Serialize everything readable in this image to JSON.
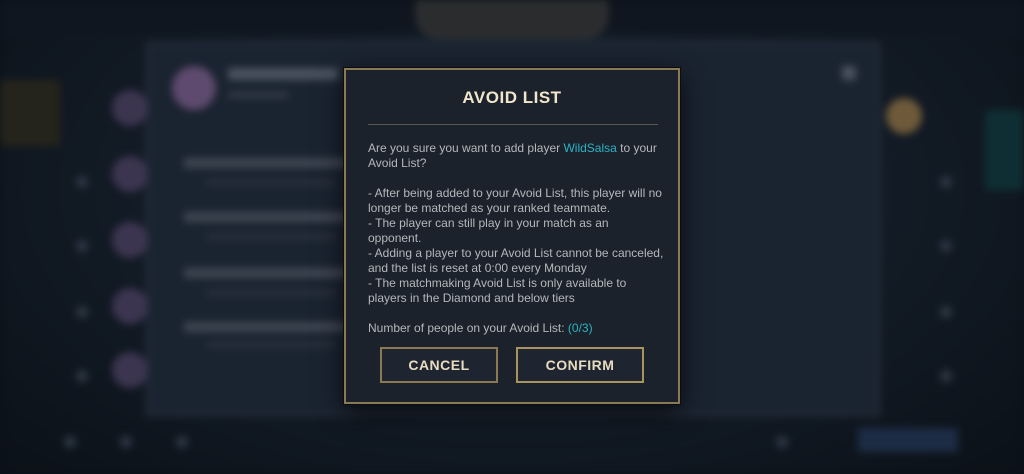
{
  "dialog": {
    "title": "AVOID LIST",
    "question_before": "Are you sure you want to add player ",
    "player_name": "WildSalsa",
    "question_after": " to your Avoid List?",
    "notes": [
      " - After being added to your Avoid List, this player will no longer be matched as your ranked teammate.",
      " - The player can still play in your match as an opponent.",
      " - Adding a player to your Avoid List cannot be canceled, and the list is reset at 0:00 every Monday",
      " - The matchmaking Avoid List is only available to players in the Diamond and below tiers"
    ],
    "count_label": "Number of people on your Avoid List: ",
    "count_value": "(0/3)",
    "cancel_label": "CANCEL",
    "confirm_label": "CONFIRM"
  },
  "colors": {
    "accent_gold": "#8a7a52",
    "highlight_cyan": "#2bb3c4",
    "title_text": "#f0e6cc",
    "body_text": "#b4b8bc",
    "dialog_bg": "#1c222b"
  }
}
